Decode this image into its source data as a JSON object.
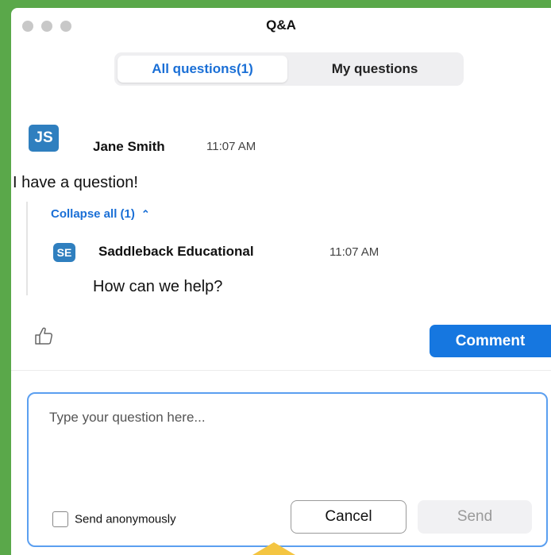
{
  "window": {
    "title": "Q&A"
  },
  "tabs": [
    {
      "label": "All questions(1)",
      "active": true
    },
    {
      "label": "My questions",
      "active": false
    }
  ],
  "question": {
    "avatar": "JS",
    "author": "Jane Smith",
    "time": "11:07 AM",
    "text": "I have a question!",
    "collapse_label": "Collapse all (1)",
    "collapse_icon": "chevron-up-icon"
  },
  "reply": {
    "avatar": "SE",
    "author": "Saddleback Educational",
    "time": "11:07 AM",
    "text": "How can we help?"
  },
  "actions": {
    "like_icon": "thumbs-up-icon",
    "comment_label": "Comment"
  },
  "composer": {
    "placeholder": "Type your question here...",
    "anonymous_label": "Send anonymously",
    "anonymous_checked": false,
    "cancel_label": "Cancel",
    "send_label": "Send"
  },
  "colors": {
    "accent": "#1677e0",
    "avatar": "#2f7fbf",
    "background": "#5aa84a",
    "pointer": "#f4c542"
  }
}
